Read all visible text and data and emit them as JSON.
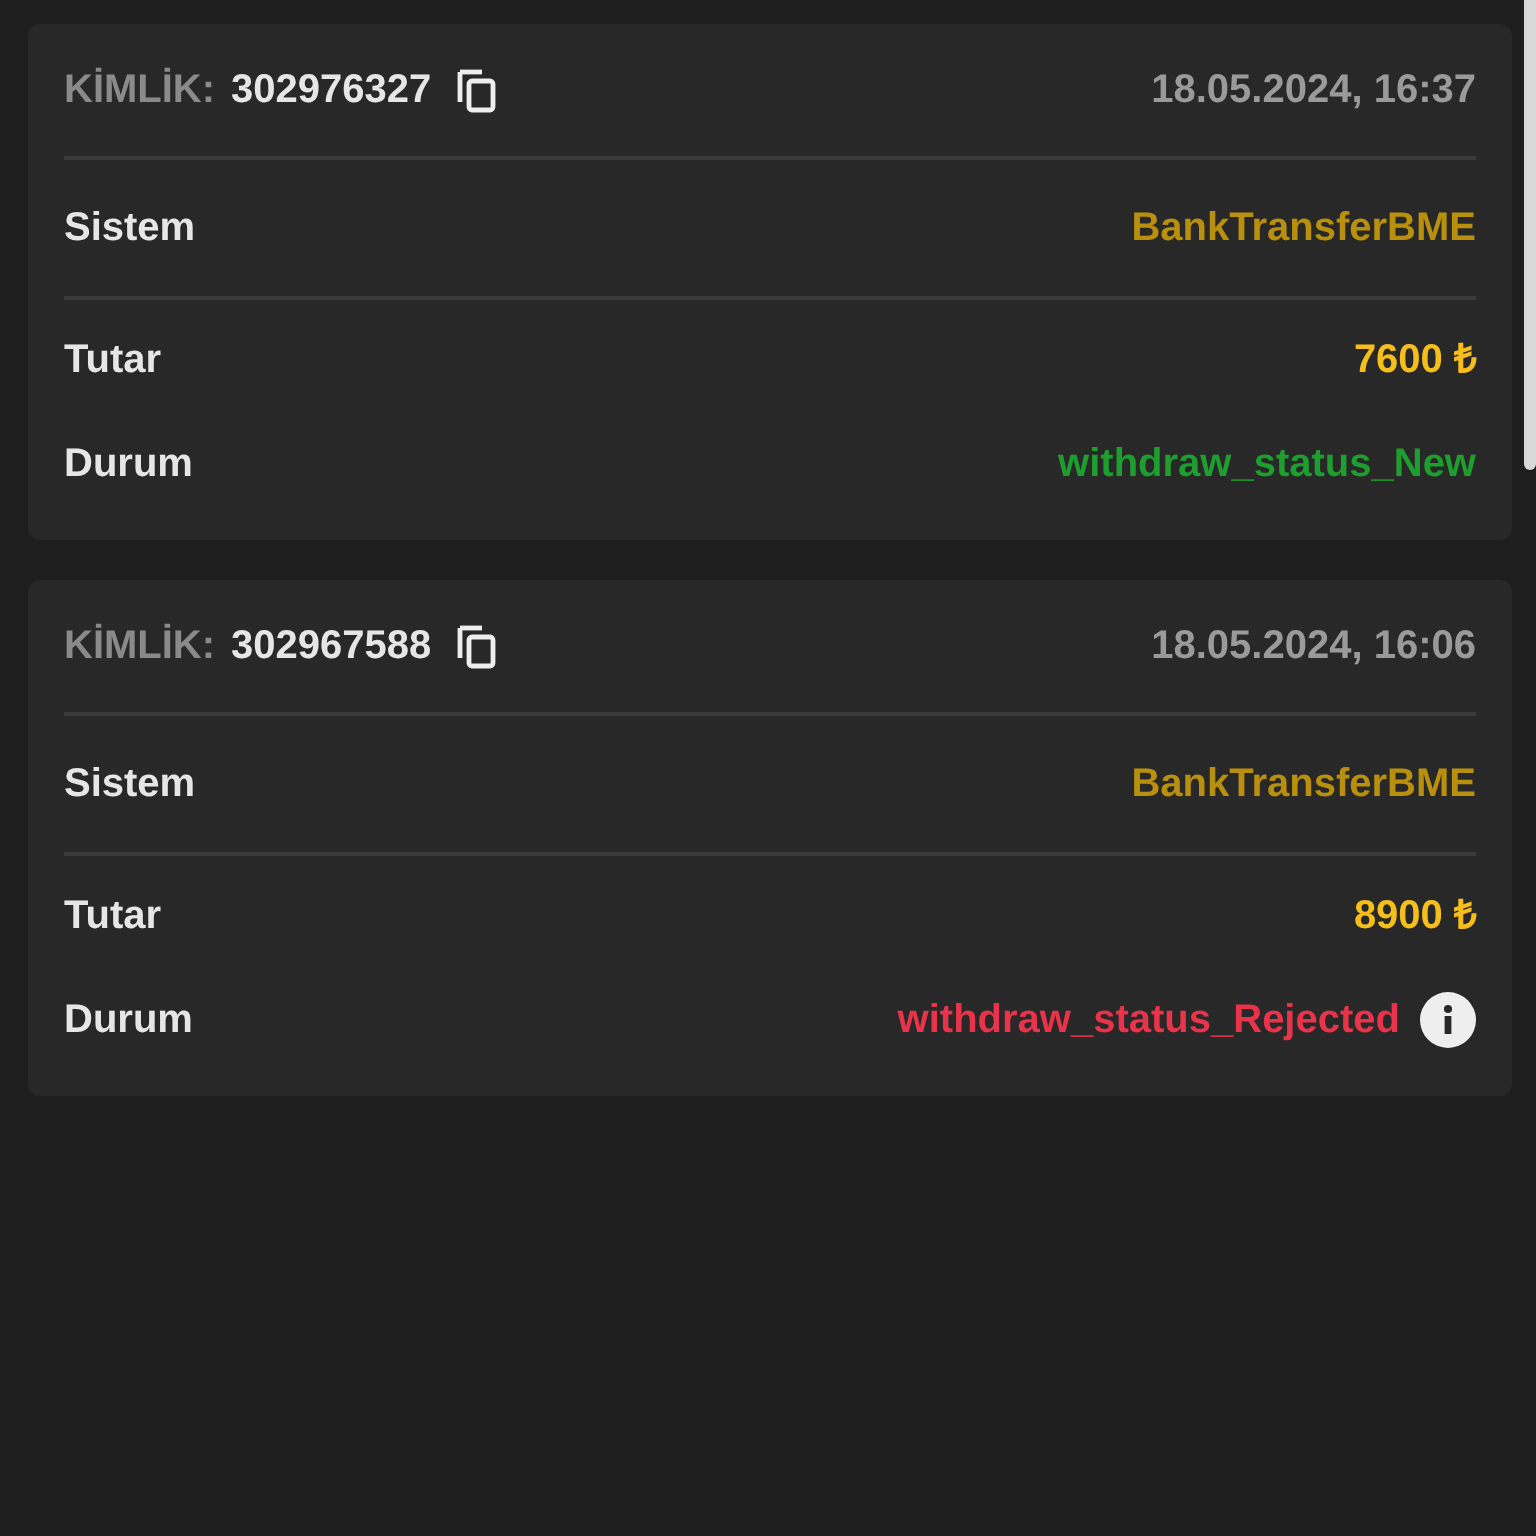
{
  "transactions": [
    {
      "id_label": "KİMLİK:",
      "id": "302976327",
      "date": "18.05.2024, 16:37",
      "system_label": "Sistem",
      "system": "BankTransferBME",
      "amount_label": "Tutar",
      "amount": "7600 ₺",
      "status_label": "Durum",
      "status": {
        "text": "withdraw_status_New",
        "color": "#1e9e2e"
      },
      "info": false
    },
    {
      "id_label": "KİMLİK:",
      "id": "302967588",
      "date": "18.05.2024, 16:06",
      "system_label": "Sistem",
      "system": "BankTransferBME",
      "amount_label": "Tutar",
      "amount": "8900 ₺",
      "status_label": "Durum",
      "status": {
        "text": "withdraw_status_Rejected",
        "color": "#e8334a"
      },
      "info": true
    }
  ]
}
